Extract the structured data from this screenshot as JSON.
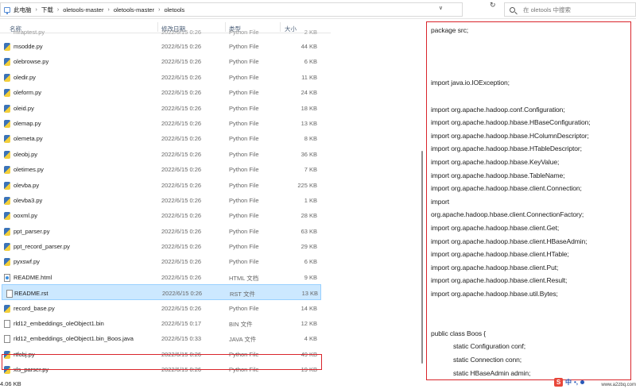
{
  "address": {
    "crumbs": [
      "此电脑",
      "下载",
      "oletools-master",
      "oletools-master",
      "oletools"
    ],
    "dropdown_glyph": "∨",
    "refresh_glyph": "↻"
  },
  "search": {
    "placeholder": "在 oletools 中搜索"
  },
  "columns": {
    "name": "名称",
    "date": "修改日期",
    "type": "类型",
    "size": "大小"
  },
  "partial_row": {
    "name": "mraptest.py",
    "date": "2022/6/15 0:26",
    "type": "Python File",
    "size": "2 KB"
  },
  "files": [
    {
      "name": "msodde.py",
      "date": "2022/6/15 0:26",
      "type": "Python File",
      "size": "44 KB",
      "icon": "python-file-icon"
    },
    {
      "name": "olebrowse.py",
      "date": "2022/6/15 0:26",
      "type": "Python File",
      "size": "6 KB",
      "icon": "python-file-icon"
    },
    {
      "name": "oledir.py",
      "date": "2022/6/15 0:26",
      "type": "Python File",
      "size": "11 KB",
      "icon": "python-file-icon"
    },
    {
      "name": "oleform.py",
      "date": "2022/6/15 0:26",
      "type": "Python File",
      "size": "24 KB",
      "icon": "python-file-icon"
    },
    {
      "name": "oleid.py",
      "date": "2022/6/15 0:26",
      "type": "Python File",
      "size": "18 KB",
      "icon": "python-file-icon"
    },
    {
      "name": "olemap.py",
      "date": "2022/6/15 0:26",
      "type": "Python File",
      "size": "13 KB",
      "icon": "python-file-icon"
    },
    {
      "name": "olemeta.py",
      "date": "2022/6/15 0:26",
      "type": "Python File",
      "size": "8 KB",
      "icon": "python-file-icon"
    },
    {
      "name": "oleobj.py",
      "date": "2022/6/15 0:26",
      "type": "Python File",
      "size": "36 KB",
      "icon": "python-file-icon"
    },
    {
      "name": "oletimes.py",
      "date": "2022/6/15 0:26",
      "type": "Python File",
      "size": "7 KB",
      "icon": "python-file-icon"
    },
    {
      "name": "olevba.py",
      "date": "2022/6/15 0:26",
      "type": "Python File",
      "size": "225 KB",
      "icon": "python-file-icon"
    },
    {
      "name": "olevba3.py",
      "date": "2022/6/15 0:26",
      "type": "Python File",
      "size": "1 KB",
      "icon": "python-file-icon"
    },
    {
      "name": "ooxml.py",
      "date": "2022/6/15 0:26",
      "type": "Python File",
      "size": "28 KB",
      "icon": "python-file-icon"
    },
    {
      "name": "ppt_parser.py",
      "date": "2022/6/15 0:26",
      "type": "Python File",
      "size": "63 KB",
      "icon": "python-file-icon"
    },
    {
      "name": "ppt_record_parser.py",
      "date": "2022/6/15 0:26",
      "type": "Python File",
      "size": "29 KB",
      "icon": "python-file-icon"
    },
    {
      "name": "pyxswf.py",
      "date": "2022/6/15 0:26",
      "type": "Python File",
      "size": "6 KB",
      "icon": "python-file-icon"
    },
    {
      "name": "README.html",
      "date": "2022/6/15 0:26",
      "type": "HTML 文档",
      "size": "9 KB",
      "icon": "html-file-icon"
    },
    {
      "name": "README.rst",
      "date": "2022/6/15 0:26",
      "type": "RST 文件",
      "size": "13 KB",
      "icon": "text-file-icon",
      "selected": true
    },
    {
      "name": "record_base.py",
      "date": "2022/6/15 0:26",
      "type": "Python File",
      "size": "14 KB",
      "icon": "python-file-icon"
    },
    {
      "name": "rld12_embeddings_oleObject1.bin",
      "date": "2022/6/15 0:17",
      "type": "BIN 文件",
      "size": "12 KB",
      "icon": "text-file-icon"
    },
    {
      "name": "rld12_embeddings_oleObject1.bin_Boos.java",
      "date": "2022/6/15 0:33",
      "type": "JAVA 文件",
      "size": "4 KB",
      "icon": "java-file-icon"
    },
    {
      "name": "rtfobj.py",
      "date": "2022/6/15 0:26",
      "type": "Python File",
      "size": "49 KB",
      "icon": "python-file-icon"
    },
    {
      "name": "xls_parser.py",
      "date": "2022/6/15 0:26",
      "type": "Python File",
      "size": "19 KB",
      "icon": "python-file-icon"
    }
  ],
  "status": {
    "size_text": "4.06 KB"
  },
  "code_lines": [
    {
      "text": "package src;",
      "row": 0
    },
    {
      "text": "import java.io.IOException;",
      "row": 4
    },
    {
      "text": "import org.apache.hadoop.conf.Configuration;",
      "row": 6
    },
    {
      "text": "import org.apache.hadoop.hbase.HBaseConfiguration;",
      "row": 7
    },
    {
      "text": "import org.apache.hadoop.hbase.HColumnDescriptor;",
      "row": 8
    },
    {
      "text": "import org.apache.hadoop.hbase.HTableDescriptor;",
      "row": 9
    },
    {
      "text": "import org.apache.hadoop.hbase.KeyValue;",
      "row": 10
    },
    {
      "text": "import org.apache.hadoop.hbase.TableName;",
      "row": 11
    },
    {
      "text": "import org.apache.hadoop.hbase.client.Connection;",
      "row": 12
    },
    {
      "text": "import",
      "row": 13
    },
    {
      "text": "org.apache.hadoop.hbase.client.ConnectionFactory;",
      "row": 14
    },
    {
      "text": "import org.apache.hadoop.hbase.client.Get;",
      "row": 15
    },
    {
      "text": "import org.apache.hadoop.hbase.client.HBaseAdmin;",
      "row": 16
    },
    {
      "text": "import org.apache.hadoop.hbase.client.HTable;",
      "row": 17
    },
    {
      "text": "import org.apache.hadoop.hbase.client.Put;",
      "row": 18
    },
    {
      "text": "import org.apache.hadoop.hbase.client.Result;",
      "row": 19
    },
    {
      "text": "import org.apache.hadoop.hbase.util.Bytes;",
      "row": 20
    },
    {
      "text": "public class Boos {",
      "row": 23
    },
    {
      "text": "static  Configuration conf;",
      "row": 24,
      "indent": true
    },
    {
      "text": "static  Connection   conn;",
      "row": 25,
      "indent": true
    },
    {
      "text": "static  HBaseAdmin   admin;",
      "row": 26,
      "indent": true
    }
  ],
  "ime": {
    "logo": "S",
    "lang": "中",
    "punct": "•,"
  },
  "watermark": "www.a2zbq.com"
}
